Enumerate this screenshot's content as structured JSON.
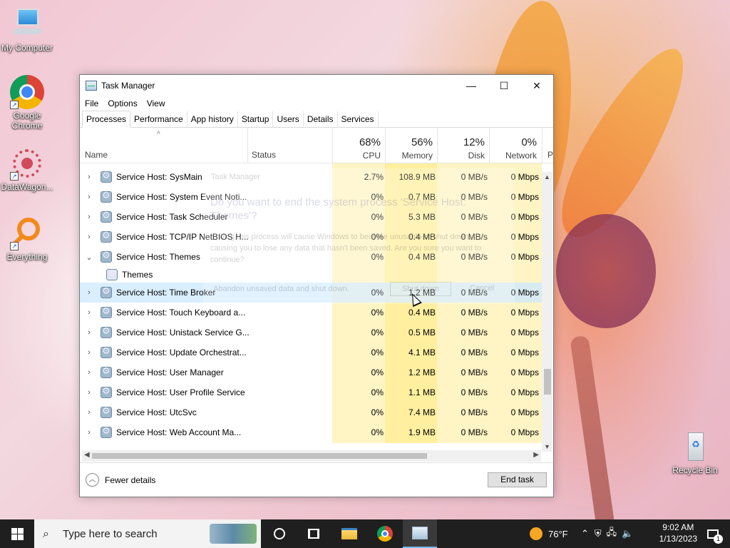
{
  "desktop": {
    "icons": [
      {
        "label": "My Computer"
      },
      {
        "label": "Google Chrome"
      },
      {
        "label": "DataWagon..."
      },
      {
        "label": "Everything"
      },
      {
        "label": "Recycle Bin"
      }
    ]
  },
  "window": {
    "title": "Task Manager",
    "controls": {
      "minimize": "—",
      "maximize": "☐",
      "close": "✕"
    },
    "menu": [
      "File",
      "Options",
      "View"
    ],
    "tabs": [
      "Processes",
      "Performance",
      "App history",
      "Startup",
      "Users",
      "Details",
      "Services"
    ],
    "active_tab": "Processes",
    "columns": {
      "name": "Name",
      "status": "Status",
      "cpu": {
        "pct": "68%",
        "label": "CPU"
      },
      "memory": {
        "pct": "56%",
        "label": "Memory"
      },
      "disk": {
        "pct": "12%",
        "label": "Disk"
      },
      "network": {
        "pct": "0%",
        "label": "Network"
      },
      "power_partial": "P"
    },
    "rows": [
      {
        "name": "Service Host: SysMain",
        "cpu": "2.7%",
        "memory": "108.9 MB",
        "disk": "0 MB/s",
        "network": "0 Mbps",
        "expand": "›"
      },
      {
        "name": "Service Host: System Event Noti...",
        "cpu": "0%",
        "memory": "0.7 MB",
        "disk": "0 MB/s",
        "network": "0 Mbps",
        "expand": "›"
      },
      {
        "name": "Service Host: Task Scheduler",
        "cpu": "0%",
        "memory": "5.3 MB",
        "disk": "0 MB/s",
        "network": "0 Mbps",
        "expand": "›"
      },
      {
        "name": "Service Host: TCP/IP NetBIOS H...",
        "cpu": "0%",
        "memory": "0.4 MB",
        "disk": "0 MB/s",
        "network": "0 Mbps",
        "expand": "›"
      },
      {
        "name": "Service Host: Themes",
        "cpu": "0%",
        "memory": "0.4 MB",
        "disk": "0 MB/s",
        "network": "0 Mbps",
        "expand": "⌄"
      },
      {
        "name": "Themes",
        "cpu": "",
        "memory": "",
        "disk": "",
        "network": "",
        "expand": "",
        "child": true
      },
      {
        "name": "Service Host: Time Broker",
        "cpu": "0%",
        "memory": "1.2 MB",
        "disk": "0 MB/s",
        "network": "0 Mbps",
        "expand": "›",
        "selected": true
      },
      {
        "name": "Service Host: Touch Keyboard a...",
        "cpu": "0%",
        "memory": "0.4 MB",
        "disk": "0 MB/s",
        "network": "0 Mbps",
        "expand": "›"
      },
      {
        "name": "Service Host: Unistack Service G...",
        "cpu": "0%",
        "memory": "0.5 MB",
        "disk": "0 MB/s",
        "network": "0 Mbps",
        "expand": "›"
      },
      {
        "name": "Service Host: Update Orchestrat...",
        "cpu": "0%",
        "memory": "4.1 MB",
        "disk": "0 MB/s",
        "network": "0 Mbps",
        "expand": "›"
      },
      {
        "name": "Service Host: User Manager",
        "cpu": "0%",
        "memory": "1.2 MB",
        "disk": "0 MB/s",
        "network": "0 Mbps",
        "expand": "›"
      },
      {
        "name": "Service Host: User Profile Service",
        "cpu": "0%",
        "memory": "1.1 MB",
        "disk": "0 MB/s",
        "network": "0 Mbps",
        "expand": "›"
      },
      {
        "name": "Service Host: UtcSvc",
        "cpu": "0%",
        "memory": "7.4 MB",
        "disk": "0 MB/s",
        "network": "0 Mbps",
        "expand": "›"
      },
      {
        "name": "Service Host: Web Account Ma...",
        "cpu": "0%",
        "memory": "1.9 MB",
        "disk": "0 MB/s",
        "network": "0 Mbps",
        "expand": "›"
      }
    ],
    "footer": {
      "fewer_details": "Fewer details",
      "end_task": "End task"
    }
  },
  "ghost_dialog": {
    "title": "Task Manager",
    "heading": "Do you want to end the system process 'Service Host: Themes'?",
    "body": "Ending this process will cause Windows to become unusable or shut down, causing you to lose any data that hasn't been saved. Are you sure you want to continue?",
    "checkbox": "Abandon unsaved data and shut down.",
    "shutdown": "Shut down",
    "cancel": "Cancel"
  },
  "taskbar": {
    "search_placeholder": "Type here to search",
    "weather": "76°F",
    "time": "9:02 AM",
    "date": "1/13/2023",
    "notification_count": "1"
  },
  "colors": {
    "heat_light": "#fff4c4",
    "heat_memory": "#ffef9f",
    "selection": "#cce8ff",
    "taskbar": "#1f1f1f"
  }
}
